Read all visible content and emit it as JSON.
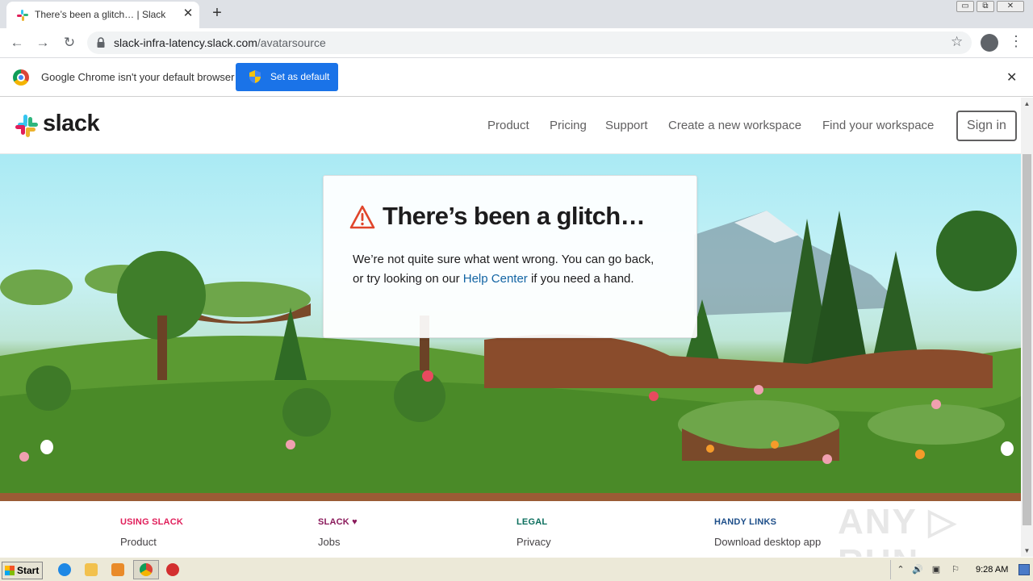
{
  "browser": {
    "tab_title": "There’s been a glitch… | Slack",
    "tab_close": "✕",
    "new_tab": "+",
    "url_domain": "slack-infra-latency.slack.com",
    "url_path": "/avatarsource",
    "window_buttons": [
      "▭",
      "⧉",
      "✕"
    ],
    "nav": {
      "back": "←",
      "forward": "→",
      "reload": "↻"
    },
    "star": "☆",
    "menu": "⋮"
  },
  "infobar": {
    "message": "Google Chrome isn't your default browser",
    "button_label": "Set as default",
    "close": "✕"
  },
  "header": {
    "logo_text": "slack",
    "nav": [
      "Product",
      "Pricing",
      "Support",
      "Create a new workspace",
      "Find your workspace"
    ],
    "signin": "Sign in"
  },
  "glitch": {
    "title": "There’s been a glitch…",
    "message_before": "We’re not quite sure what went wrong. You can go back, or try looking on our ",
    "link": "Help Center",
    "message_after": " if you need a hand."
  },
  "footer": {
    "columns": [
      {
        "heading": "USING SLACK",
        "color": "#e01e5a",
        "link": "Product"
      },
      {
        "heading": "SLACK ♥",
        "color": "#8a1a5b",
        "link": "Jobs"
      },
      {
        "heading": "LEGAL",
        "color": "#0b6e5d",
        "link": "Privacy"
      },
      {
        "heading": "HANDY LINKS",
        "color": "#1d4e89",
        "link": "Download desktop app"
      }
    ],
    "watermark": "ANY ▷ RUN"
  },
  "scrollbar": {
    "up": "▲",
    "down": "▼"
  },
  "taskbar": {
    "start": "Start",
    "clock": "9:28 AM",
    "tray_icons": [
      "⌃",
      "🔊",
      "▣",
      "⚐"
    ]
  },
  "colors": {
    "slack_aubergine": "#1d1c1d",
    "link_blue": "#1264a3",
    "warning_red": "#e01e5a",
    "chrome_blue_button": "#1a73e8"
  }
}
